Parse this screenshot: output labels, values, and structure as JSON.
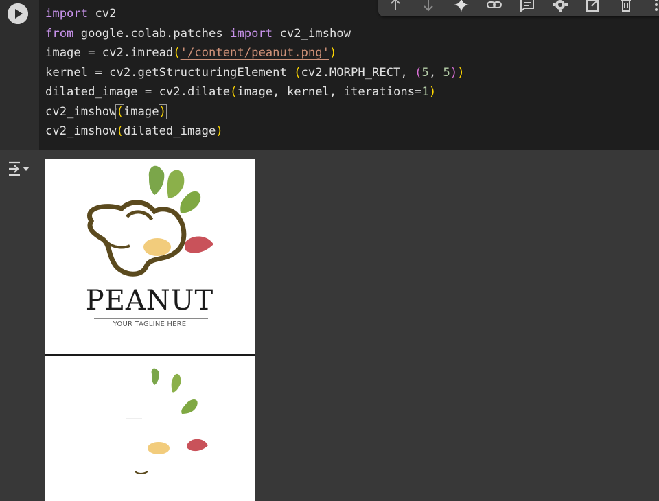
{
  "cell": {
    "run_icon": "play-icon",
    "code_lines": [
      [
        {
          "t": "import",
          "c": "kw"
        },
        {
          "t": " cv2",
          "c": ""
        }
      ],
      [
        {
          "t": "from",
          "c": "kw"
        },
        {
          "t": " google.colab.patches ",
          "c": ""
        },
        {
          "t": "import",
          "c": "kw"
        },
        {
          "t": " cv2_imshow",
          "c": ""
        }
      ],
      [
        {
          "t": "image = cv2.imread",
          "c": ""
        },
        {
          "t": "(",
          "c": "par"
        },
        {
          "t": "'/content/peanut.png'",
          "c": "str"
        },
        {
          "t": ")",
          "c": "par"
        }
      ],
      [
        {
          "t": "kernel = cv2.getStructuringElement ",
          "c": ""
        },
        {
          "t": "(",
          "c": "par"
        },
        {
          "t": "cv2.MORPH_RECT, ",
          "c": ""
        },
        {
          "t": "(",
          "c": "par2"
        },
        {
          "t": "5",
          "c": "num"
        },
        {
          "t": ", ",
          "c": ""
        },
        {
          "t": "5",
          "c": "num"
        },
        {
          "t": ")",
          "c": "par2"
        },
        {
          "t": ")",
          "c": "par"
        }
      ],
      [
        {
          "t": "dilated_image = cv2.dilate",
          "c": ""
        },
        {
          "t": "(",
          "c": "par"
        },
        {
          "t": "image, kernel, iterations=",
          "c": ""
        },
        {
          "t": "1",
          "c": "num"
        },
        {
          "t": ")",
          "c": "par"
        }
      ],
      [
        {
          "t": "cv2_imshow",
          "c": ""
        },
        {
          "t": "(",
          "c": "par bracket-hl"
        },
        {
          "t": "image",
          "c": ""
        },
        {
          "t": ")",
          "c": "par bracket-hl"
        }
      ],
      [
        {
          "t": "cv2_imshow",
          "c": ""
        },
        {
          "t": "(",
          "c": "par"
        },
        {
          "t": "dilated_image",
          "c": ""
        },
        {
          "t": ")",
          "c": "par"
        }
      ]
    ]
  },
  "toolbar": {
    "buttons": [
      "move-up-icon",
      "move-down-icon",
      "gemini-sparkle-icon",
      "link-icon",
      "comment-icon",
      "settings-gear-icon",
      "open-in-tab-icon",
      "delete-icon",
      "more-icon"
    ]
  },
  "output": {
    "toggle_icon": "output-collapse-icon",
    "image1": {
      "logo_text": "PEANUT",
      "tagline": "YOUR TAGLINE HERE"
    }
  },
  "colors": {
    "code_bg": "#1e1e1e",
    "gutter_bg": "#2d2d2d",
    "output_bg": "#383838",
    "keyword": "#c792ea",
    "string": "#ce9178",
    "number": "#b5cea8",
    "paren": "#ffd700"
  }
}
